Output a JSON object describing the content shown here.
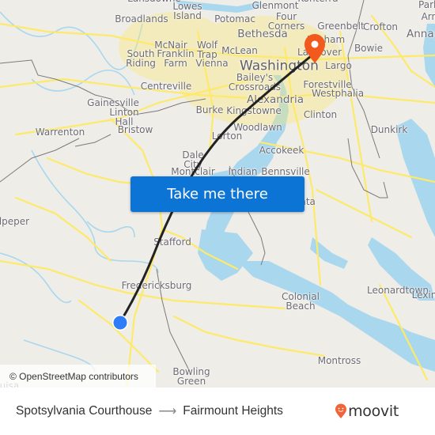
{
  "map": {
    "attribution": "© OpenStreetMap contributors",
    "colors": {
      "land": "#efede8",
      "water": "#a9d7ee",
      "road": "#fde96a",
      "border": "#7d7a78",
      "route": "#222222",
      "origin_marker": "#2f7cf6",
      "destination_marker": "#f25a1d"
    },
    "places": [
      {
        "name": "Lansdowne",
        "size": "sm"
      },
      {
        "name": "Lowes\nIsland",
        "size": "sm"
      },
      {
        "name": "Broadlands",
        "size": "sm"
      },
      {
        "name": "Potomac",
        "size": "sm"
      },
      {
        "name": "Glenmont",
        "size": "sm"
      },
      {
        "name": "Four\nCorners",
        "size": "sm"
      },
      {
        "name": "Konterra",
        "size": "sm"
      },
      {
        "name": "Greenbelt",
        "size": "sm"
      },
      {
        "name": "Crofton",
        "size": "sm"
      },
      {
        "name": "Park",
        "size": "sm"
      },
      {
        "name": "Arnold",
        "size": "sm"
      },
      {
        "name": "Annapolis",
        "size": "med"
      },
      {
        "name": "Bethesda",
        "size": "med"
      },
      {
        "name": "McNair",
        "size": "sm"
      },
      {
        "name": "Wolf\nTrap",
        "size": "sm"
      },
      {
        "name": "Franklin\nFarm",
        "size": "sm"
      },
      {
        "name": "South\nRiding",
        "size": "sm"
      },
      {
        "name": "Vienna",
        "size": "sm"
      },
      {
        "name": "McLean",
        "size": "sm"
      },
      {
        "name": "Lanham",
        "size": "sm"
      },
      {
        "name": "Landover",
        "size": "sm"
      },
      {
        "name": "Bowie",
        "size": "sm"
      },
      {
        "name": "Washington",
        "size": "big"
      },
      {
        "name": "Largo",
        "size": "sm"
      },
      {
        "name": "Centreville",
        "size": "sm"
      },
      {
        "name": "Bailey's\nCrossroads",
        "size": "sm"
      },
      {
        "name": "Forestville",
        "size": "sm"
      },
      {
        "name": "Westphalia",
        "size": "sm"
      },
      {
        "name": "Alexandria",
        "size": "med"
      },
      {
        "name": "Gainesville",
        "size": "sm"
      },
      {
        "name": "Linton\nHall",
        "size": "sm"
      },
      {
        "name": "Burke",
        "size": "sm"
      },
      {
        "name": "Kingstowne",
        "size": "sm"
      },
      {
        "name": "Clinton",
        "size": "sm"
      },
      {
        "name": "Warrenton",
        "size": "sm"
      },
      {
        "name": "Bristow",
        "size": "sm"
      },
      {
        "name": "Woodlawn",
        "size": "sm"
      },
      {
        "name": "Lorton",
        "size": "sm"
      },
      {
        "name": "Dunkirk",
        "size": "sm"
      },
      {
        "name": "Accokeek",
        "size": "sm"
      },
      {
        "name": "Dale\nCity",
        "size": "sm"
      },
      {
        "name": "Montclair",
        "size": "sm"
      },
      {
        "name": "Indian",
        "size": "sm"
      },
      {
        "name": "Bennsville",
        "size": "sm"
      },
      {
        "name": "Culpeper",
        "size": "sm"
      },
      {
        "name": "La Plata",
        "size": "sm"
      },
      {
        "name": "Stafford",
        "size": "sm"
      },
      {
        "name": "Fredericksburg",
        "size": "sm"
      },
      {
        "name": "Colonial\nBeach",
        "size": "sm"
      },
      {
        "name": "Leonardtown",
        "size": "sm"
      },
      {
        "name": "Lexington Park",
        "size": "sm"
      },
      {
        "name": "Montross",
        "size": "sm"
      },
      {
        "name": "Bowling\nGreen",
        "size": "sm"
      },
      {
        "name": "Louisa",
        "size": "sm"
      }
    ]
  },
  "cta_button": {
    "label": "Take me there",
    "color": "#0c74d4"
  },
  "footer": {
    "origin": "Spotsylvania Courthouse",
    "arrow": "⟶",
    "destination": "Fairmount Heights",
    "brand": "moovit",
    "brand_color": "#f0643a"
  }
}
